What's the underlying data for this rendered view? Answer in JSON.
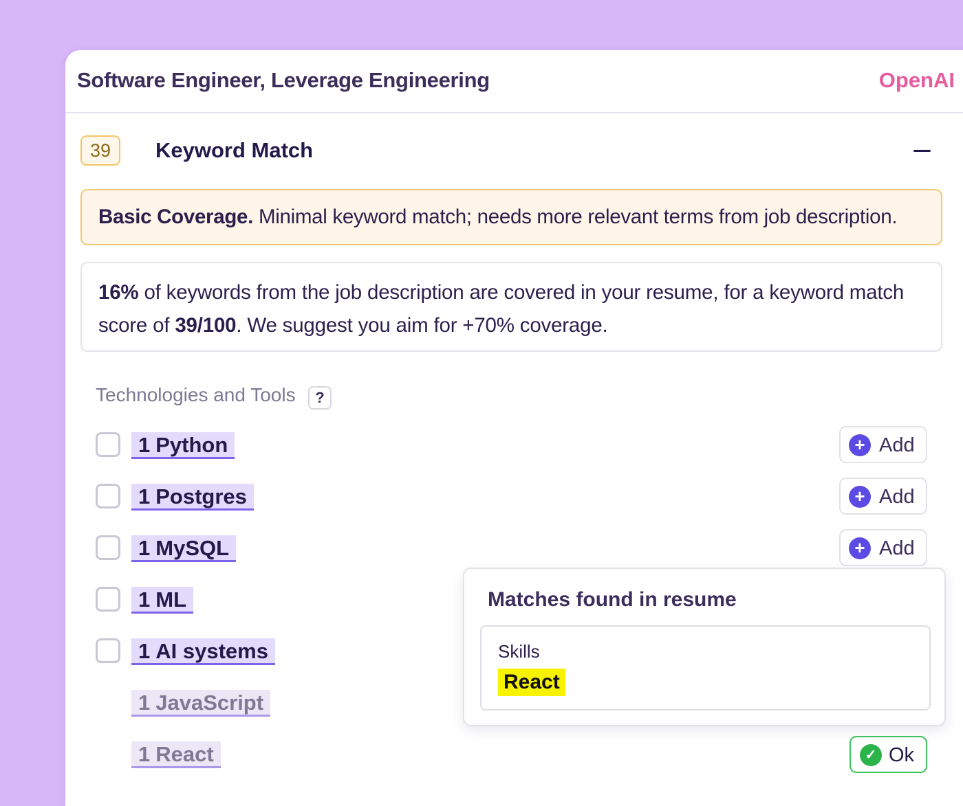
{
  "header": {
    "job_title": "Software Engineer, Leverage Engineering",
    "company": "OpenAI"
  },
  "keyword_match": {
    "score": "39",
    "title": "Keyword Match",
    "collapse_icon": "minus-icon",
    "banner": {
      "label": "Basic Coverage.",
      "text": " Minimal keyword match; needs more relevant terms from job description."
    },
    "info": {
      "pct": "16%",
      "text1": " of keywords from the job description are covered in your resume, for a keyword match score of ",
      "score": "39/100",
      "text2": ". We suggest you aim for +70% coverage."
    }
  },
  "category": {
    "name": "Technologies and Tools",
    "help": "?"
  },
  "keywords": [
    {
      "count": "1",
      "name": "Python",
      "status": "missing",
      "action": "Add"
    },
    {
      "count": "1",
      "name": "Postgres",
      "status": "missing",
      "action": "Add"
    },
    {
      "count": "1",
      "name": "MySQL",
      "status": "missing",
      "action": "Add"
    },
    {
      "count": "1",
      "name": "ML",
      "status": "missing"
    },
    {
      "count": "1",
      "name": "AI systems",
      "status": "missing"
    },
    {
      "count": "1",
      "name": "JavaScript",
      "status": "matched"
    },
    {
      "count": "1",
      "name": "React",
      "status": "matched",
      "action": "Ok"
    }
  ],
  "popover": {
    "title": "Matches found in resume",
    "section": "Skills",
    "term": "React"
  },
  "colors": {
    "background": "#d6b6f7",
    "brand": "#e75c9f",
    "accent": "#5b4ae3",
    "ok": "#2bb44a",
    "warning": "#f3c977",
    "highlight": "#f7f200"
  }
}
